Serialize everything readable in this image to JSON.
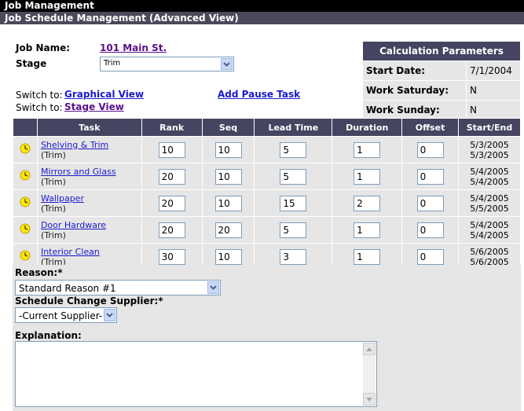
{
  "header": {
    "title": "Job Management",
    "subtitle": "Job Schedule Management (Advanced View)"
  },
  "job": {
    "name_label": "Job Name:",
    "name_value": "101 Main St.",
    "stage_label": "Stage",
    "stage_value": "Trim"
  },
  "switch": {
    "prefix": "Switch to:",
    "graphical_label": "Graphical View",
    "stage_label": "Stage View"
  },
  "add_pause_label": "Add Pause Task",
  "params": {
    "title": "Calculation Parameters",
    "rows": [
      {
        "label": "Start Date:",
        "value": "7/1/2004"
      },
      {
        "label": "Work Saturday:",
        "value": "N"
      },
      {
        "label": "Work Sunday:",
        "value": "N"
      }
    ]
  },
  "table": {
    "columns": [
      "Task",
      "Rank",
      "Seq",
      "Lead Time",
      "Duration",
      "Offset",
      "Start/End"
    ],
    "rows": [
      {
        "task": "Shelving & Trim",
        "stage": "(Trim)",
        "rank": "10",
        "seq": "10",
        "lead": "5",
        "duration": "1",
        "offset": "0",
        "start": "5/3/2005",
        "end": "5/3/2005"
      },
      {
        "task": "Mirrors and Glass",
        "stage": "(Trim)",
        "rank": "20",
        "seq": "10",
        "lead": "5",
        "duration": "1",
        "offset": "0",
        "start": "5/4/2005",
        "end": "5/4/2005"
      },
      {
        "task": "Wallpaper",
        "stage": "(Trim)",
        "rank": "20",
        "seq": "10",
        "lead": "15",
        "duration": "2",
        "offset": "0",
        "start": "5/4/2005",
        "end": "5/5/2005"
      },
      {
        "task": "Door Hardware",
        "stage": "(Trim)",
        "rank": "20",
        "seq": "20",
        "lead": "5",
        "duration": "1",
        "offset": "0",
        "start": "5/4/2005",
        "end": "5/4/2005"
      },
      {
        "task": "Interior Clean",
        "stage": "(Trim)",
        "rank": "30",
        "seq": "10",
        "lead": "3",
        "duration": "1",
        "offset": "0",
        "start": "5/6/2005",
        "end": "5/6/2005"
      }
    ]
  },
  "reason": {
    "label": "Reason:*",
    "value": "Standard Reason #1"
  },
  "supplier": {
    "label": "Schedule Change Supplier:*",
    "value": "-Current Supplier-"
  },
  "explanation": {
    "label": "Explanation:",
    "value": ""
  },
  "icons": {
    "task_status": "clock-icon",
    "dropdown": "chevron-down-icon"
  },
  "colors": {
    "header_bg": "#454561",
    "link_purple": "#5a0f8a",
    "link_blue": "#1a1ad0",
    "row_bg": "#e6e6e6"
  }
}
